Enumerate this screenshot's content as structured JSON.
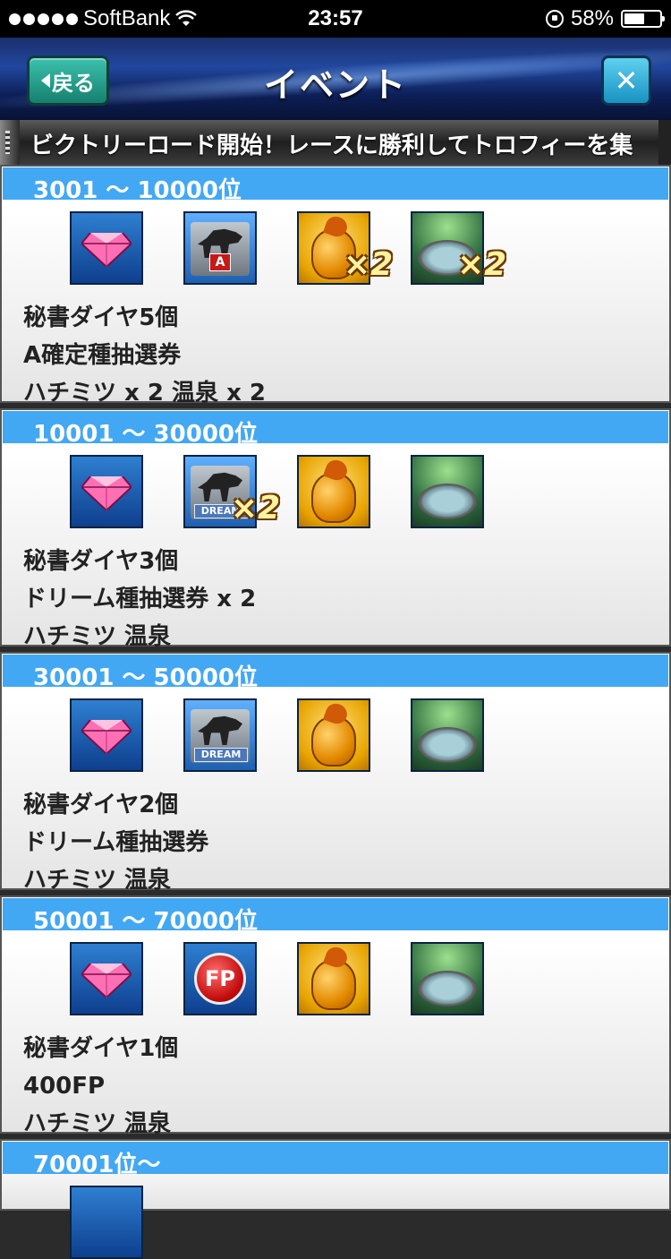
{
  "status": {
    "carrier": "SoftBank",
    "time": "23:57",
    "battery": "58%",
    "battery_level": 0.58
  },
  "header": {
    "back_label": "戻る",
    "title": "イベント",
    "close_label": "✕"
  },
  "ticker": {
    "text": "ビクトリーロード開始！レースに勝利してトロフィーを集"
  },
  "sections": [
    {
      "rank": "3001 〜 10000位",
      "icons": [
        "diamond-icon",
        "a-ticket-icon",
        "honey-icon",
        "onsen-icon"
      ],
      "multipliers": {
        "honey": "×2",
        "onsen": "×2"
      },
      "lines": [
        "秘書ダイヤ5個",
        "A確定種抽選券",
        "ハチミツ x 2 温泉 x 2"
      ]
    },
    {
      "rank": "10001 〜 30000位",
      "icons": [
        "diamond-icon",
        "dream-ticket-icon",
        "honey-icon",
        "onsen-icon"
      ],
      "multipliers": {
        "dream": "×2"
      },
      "dream_label": "DREAM",
      "lines": [
        "秘書ダイヤ3個",
        "ドリーム種抽選券 x 2",
        "ハチミツ 温泉"
      ]
    },
    {
      "rank": "30001 〜 50000位",
      "icons": [
        "diamond-icon",
        "dream-ticket-icon",
        "honey-icon",
        "onsen-icon"
      ],
      "dream_label": "DREAM",
      "lines": [
        "秘書ダイヤ2個",
        "ドリーム種抽選券",
        "ハチミツ 温泉"
      ]
    },
    {
      "rank": "50001 〜 70000位",
      "icons": [
        "diamond-icon",
        "fp-icon",
        "honey-icon",
        "onsen-icon"
      ],
      "fp_label": "FP",
      "lines": [
        "秘書ダイヤ1個",
        "400FP",
        "ハチミツ 温泉"
      ]
    },
    {
      "rank": "70001位〜"
    }
  ],
  "a_badge": "A"
}
